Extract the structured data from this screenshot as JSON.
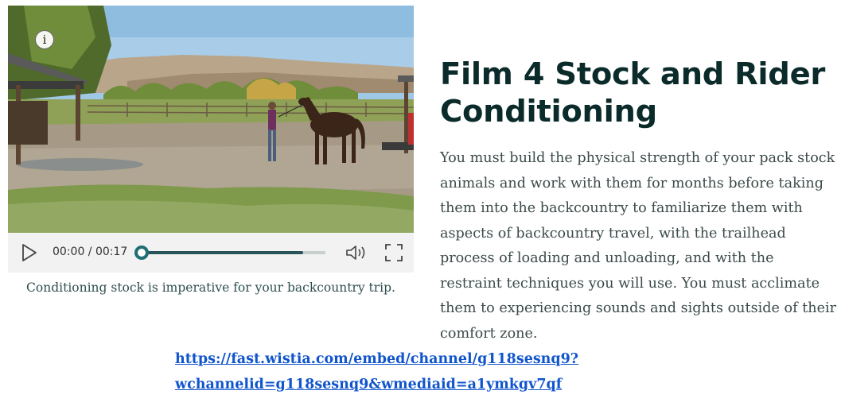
{
  "video": {
    "info_glyph": "i",
    "time_display": "00:00 / 00:17",
    "buffered_fraction": 0.88,
    "played_fraction": 0.0,
    "caption": "Conditioning stock is imperative for your backcountry trip."
  },
  "article": {
    "title": "Film 4 Stock and Rider Conditioning",
    "body": "You must build the physical strength of your pack stock animals and work with them for months before taking them into the backcountry to familiarize them with aspects of backcountry travel, with the trailhead process of loading and unloading, and with the restraint techniques you will use. You must acclimate them to experiencing sounds and sights outside of their comfort zone."
  },
  "link": {
    "line1": "https://fast.wistia.com/embed/channel/g118sesnq9?",
    "line2": "wchannelid=g118sesnq9&wmediaid=a1ymkgv7qf"
  },
  "colors": {
    "title": "#0b2b2b",
    "body": "#3c4a4a",
    "link": "#1155cc",
    "progress_accent": "#1f6e76"
  },
  "icons": [
    "info-icon",
    "play-icon",
    "volume-icon",
    "fullscreen-icon"
  ]
}
